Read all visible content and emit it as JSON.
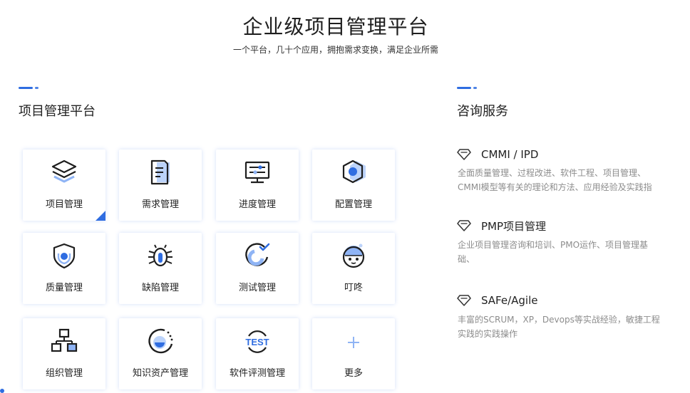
{
  "hero": {
    "title": "企业级项目管理平台",
    "subtitle": "一个平台，几十个应用，拥抱需求变换，满足企业所需"
  },
  "platform": {
    "title": "项目管理平台",
    "cards": [
      {
        "label": "项目管理",
        "icon": "layers-icon",
        "active": true
      },
      {
        "label": "需求管理",
        "icon": "document-icon"
      },
      {
        "label": "进度管理",
        "icon": "monitor-icon"
      },
      {
        "label": "配置管理",
        "icon": "hexagon-icon"
      },
      {
        "label": "质量管理",
        "icon": "shield-icon"
      },
      {
        "label": "缺陷管理",
        "icon": "bug-icon"
      },
      {
        "label": "测试管理",
        "icon": "check-gauge-icon"
      },
      {
        "label": "叮咚",
        "icon": "mascot-icon"
      },
      {
        "label": "组织管理",
        "icon": "org-chart-icon"
      },
      {
        "label": "知识资产管理",
        "icon": "knowledge-icon"
      },
      {
        "label": "软件评测管理",
        "icon": "test-icon"
      },
      {
        "label": "更多",
        "icon": "plus-icon"
      }
    ]
  },
  "consulting": {
    "title": "咨询服务",
    "items": [
      {
        "title": "CMMI / IPD",
        "desc": "全面质量管理、过程改进、软件工程、项目管理、CMMI模型等有关的理论和方法、应用经验及实践指"
      },
      {
        "title": "PMP项目管理",
        "desc": "企业项目管理咨询和培训、PMO运作、项目管理基础、"
      },
      {
        "title": "SAFe/Agile",
        "desc": "丰富的SCRUM，XP，Devops等实战经验，敏捷工程实践的实践操作"
      }
    ]
  },
  "colors": {
    "accent": "#2f6de1",
    "light_accent": "#8fb4f5",
    "muted_text": "#8c8c8c"
  }
}
